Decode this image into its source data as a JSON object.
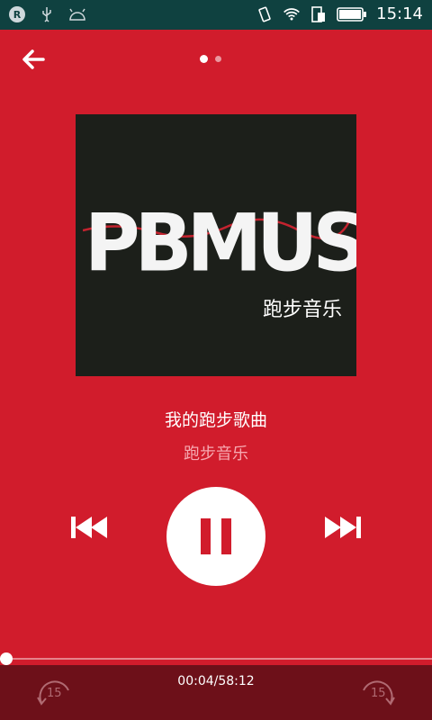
{
  "status_bar": {
    "time": "15:14",
    "left_icons": [
      "app-icon",
      "usb-icon",
      "android-debug-icon"
    ],
    "right_icons": [
      "vibrate-icon",
      "wifi-icon",
      "sim-icon",
      "battery-icon"
    ],
    "app_icon_letter": "R"
  },
  "pager": {
    "total": 2,
    "active_index": 0
  },
  "cover": {
    "logo_text": "PBMUSIC",
    "subtitle": "跑步音乐"
  },
  "track": {
    "title": "我的跑步歌曲",
    "artist": "跑步音乐"
  },
  "playback": {
    "state": "playing",
    "time_display": "00:04/58:12",
    "progress_fraction": 0.0015
  },
  "skip": {
    "back_seconds": "15",
    "forward_seconds": "15"
  },
  "colors": {
    "background": "#d11c2c",
    "status_bar": "#0f4140",
    "bottom_bar": "#6d1019"
  }
}
